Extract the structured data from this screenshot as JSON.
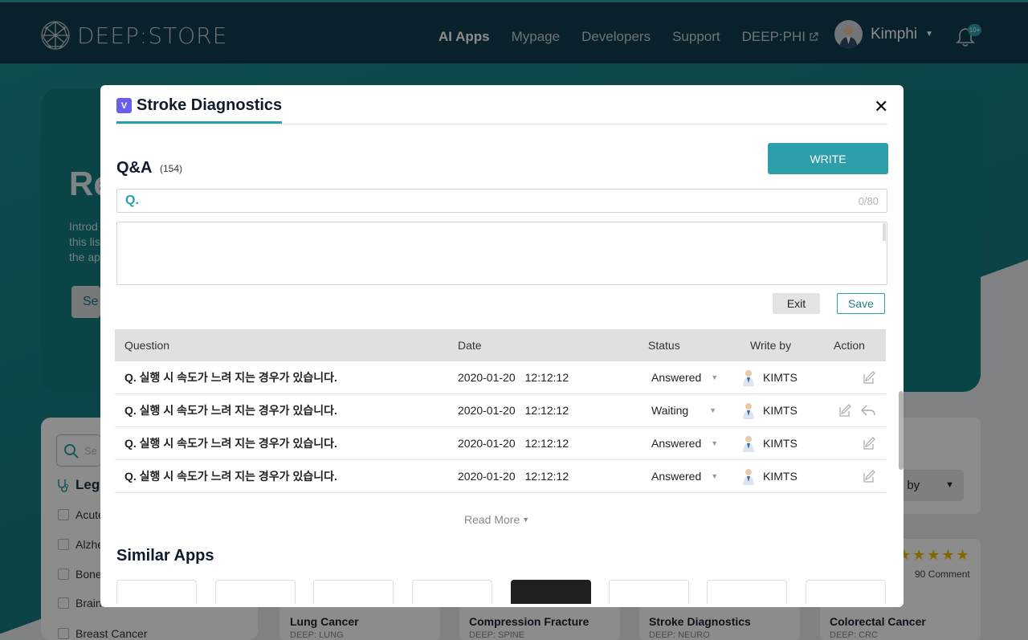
{
  "app": {
    "logo_text": "DEEP:STORE",
    "nav": [
      "AI Apps",
      "Mypage",
      "Developers",
      "Support",
      "DEEP:PHI"
    ],
    "user_name": "Kimphi",
    "notification_badge": "10+"
  },
  "background": {
    "hero_title": "Re",
    "hero_desc_lines": [
      "Introd",
      "this lis",
      "the ap"
    ],
    "hero_button": "Se",
    "sidebar_search_placeholder": "Se",
    "sidebar_heading": "Legi",
    "sidebar_items": [
      "Acute",
      "Alzhe",
      "Bone",
      "Brain",
      "Breast Cancer"
    ],
    "sort_label": "t by",
    "rating_stars": 5,
    "rating_count": "90 Comment",
    "cards": [
      {
        "title": "Lung Cancer",
        "sub": "DEEP: LUNG"
      },
      {
        "title": "Compression Fracture",
        "sub": "DEEP: SPINE"
      },
      {
        "title": "Stroke Diagnostics",
        "sub": "DEEP: NEURO"
      },
      {
        "title": "Colorectal Cancer",
        "sub": "DEEP: CRC"
      }
    ]
  },
  "modal": {
    "title": "Stroke Diagnostics",
    "qa_title": "Q&A",
    "qa_count": "(154)",
    "write_label": "WRITE",
    "q_prefix": "Q.",
    "q_value": "",
    "q_counter": "0/80",
    "body_value": "",
    "exit_label": "Exit",
    "save_label": "Save",
    "columns": [
      "Question",
      "Date",
      "Status",
      "Write by",
      "Action"
    ],
    "rows": [
      {
        "question": "Q. 실행 시 속도가 느려 지는 경우가 있습니다.",
        "date": "2020-01-20",
        "time": "12:12:12",
        "status": "Answered",
        "writer": "KIMTS",
        "reply": false
      },
      {
        "question": "Q. 실행 시 속도가 느려 지는 경우가 있습니다.",
        "date": "2020-01-20",
        "time": "12:12:12",
        "status": "Waiting",
        "writer": "KIMTS",
        "reply": true
      },
      {
        "question": "Q. 실행 시 속도가 느려 지는 경우가 있습니다.",
        "date": "2020-01-20",
        "time": "12:12:12",
        "status": "Answered",
        "writer": "KIMTS",
        "reply": false
      },
      {
        "question": "Q. 실행 시 속도가 느려 지는 경우가 있습니다.",
        "date": "2020-01-20",
        "time": "12:12:12",
        "status": "Answered",
        "writer": "KIMTS",
        "reply": false
      }
    ],
    "read_more": "Read More",
    "similar_title": "Similar Apps"
  },
  "colors": {
    "accent": "#2aa0ae",
    "topbar": "#0f3c4d",
    "hero": "#137c80"
  }
}
